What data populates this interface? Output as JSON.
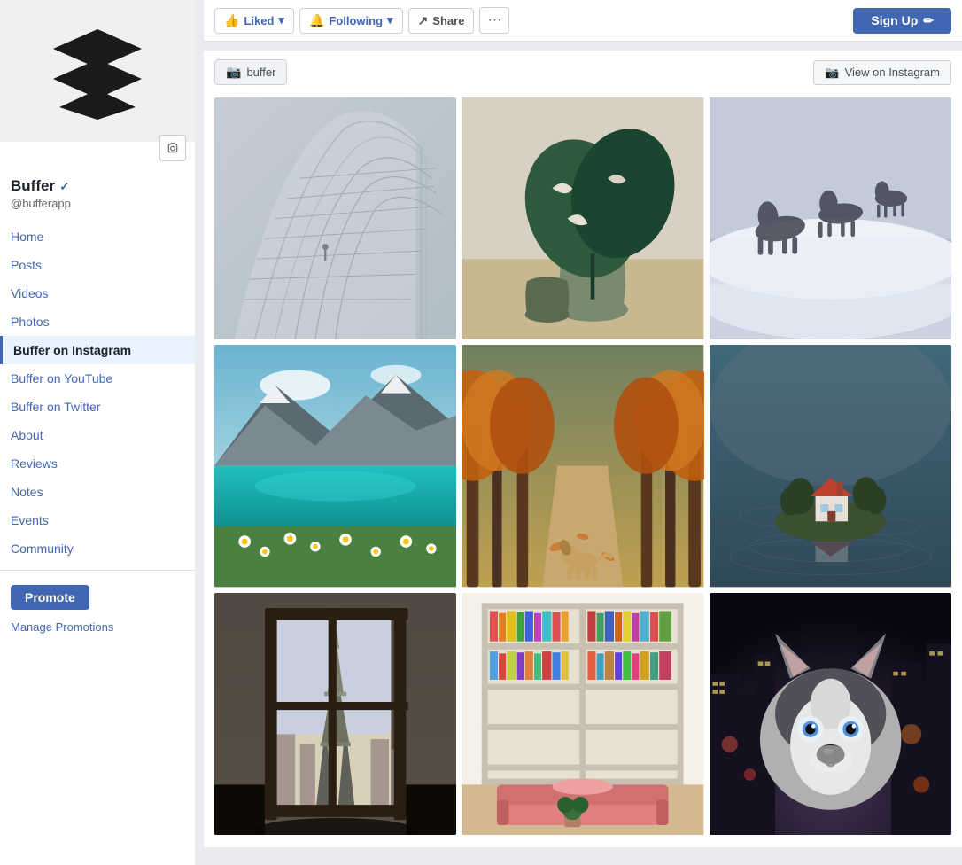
{
  "sidebar": {
    "page_name": "Buffer",
    "page_handle": "@bufferapp",
    "verified": true,
    "nav_items": [
      {
        "label": "Home",
        "active": false,
        "id": "home"
      },
      {
        "label": "Posts",
        "active": false,
        "id": "posts"
      },
      {
        "label": "Videos",
        "active": false,
        "id": "videos"
      },
      {
        "label": "Photos",
        "active": false,
        "id": "photos"
      },
      {
        "label": "Buffer on Instagram",
        "active": true,
        "id": "buffer-on-instagram"
      },
      {
        "label": "Buffer on YouTube",
        "active": false,
        "id": "buffer-on-youtube"
      },
      {
        "label": "Buffer on Twitter",
        "active": false,
        "id": "buffer-on-twitter"
      },
      {
        "label": "About",
        "active": false,
        "id": "about"
      },
      {
        "label": "Reviews",
        "active": false,
        "id": "reviews"
      },
      {
        "label": "Notes",
        "active": false,
        "id": "notes"
      },
      {
        "label": "Events",
        "active": false,
        "id": "events"
      },
      {
        "label": "Community",
        "active": false,
        "id": "community"
      }
    ],
    "promote_label": "Promote",
    "manage_promotions_label": "Manage Promotions"
  },
  "action_bar": {
    "liked_label": "Liked",
    "following_label": "Following",
    "share_label": "Share",
    "more_label": "···",
    "signup_label": "Sign Up"
  },
  "instagram_section": {
    "tab_label": "buffer",
    "view_on_instagram_label": "View on Instagram"
  },
  "photos": [
    {
      "id": "photo-1",
      "alt": "Architecture building interior"
    },
    {
      "id": "photo-2",
      "alt": "Monstera plant in vase"
    },
    {
      "id": "photo-3",
      "alt": "Horses in mist"
    },
    {
      "id": "photo-4",
      "alt": "Mountain lake with flowers"
    },
    {
      "id": "photo-5",
      "alt": "Autumn tree path with dog"
    },
    {
      "id": "photo-6",
      "alt": "Tiny island house"
    },
    {
      "id": "photo-7",
      "alt": "Eiffel Tower window view"
    },
    {
      "id": "photo-8",
      "alt": "Colorful bookshelf living room"
    },
    {
      "id": "photo-9",
      "alt": "Husky dog city night"
    }
  ]
}
